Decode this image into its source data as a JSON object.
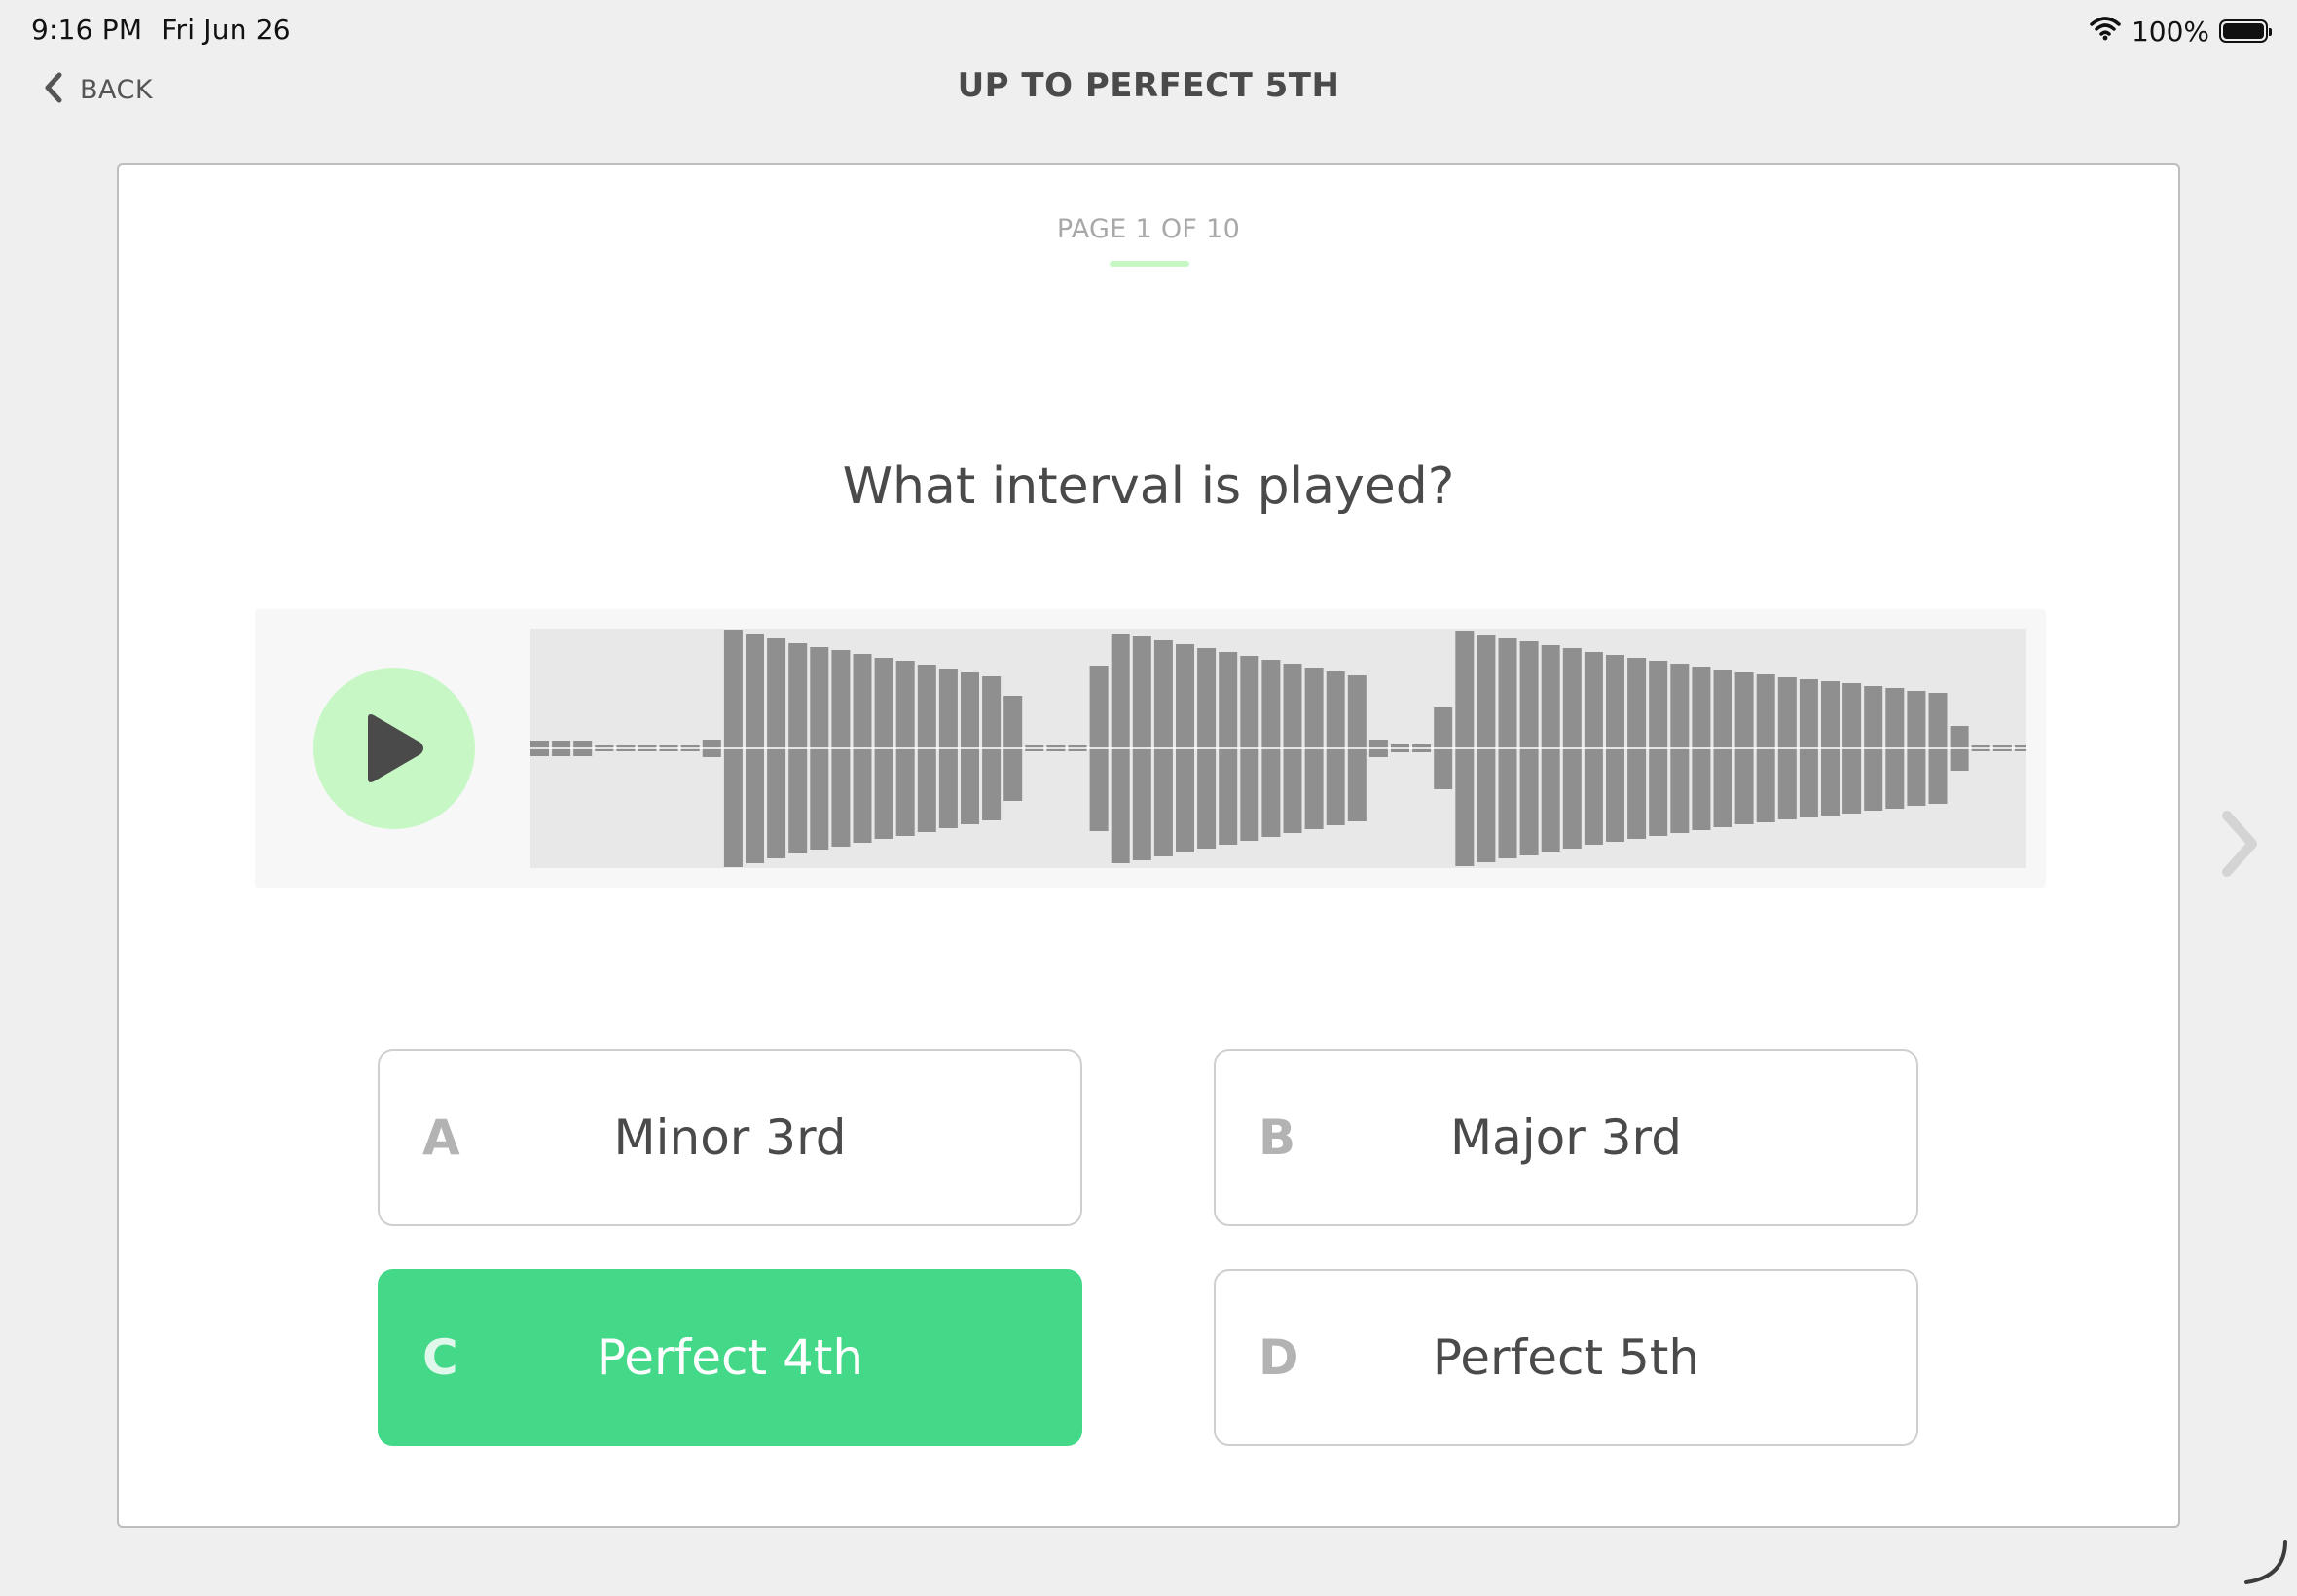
{
  "status_bar": {
    "time": "9:16 PM",
    "date": "Fri Jun 26",
    "battery": "100%",
    "battery_level": 1.0,
    "icons": [
      "wifi-icon",
      "battery-icon"
    ]
  },
  "header": {
    "back_label": "BACK",
    "title": "UP TO PERFECT 5TH"
  },
  "quiz": {
    "page_indicator": "PAGE 1 OF 10",
    "current_page": 1,
    "total_pages": 10,
    "question": "What interval is played?"
  },
  "player": {
    "icon": "play-icon"
  },
  "answers": [
    {
      "letter": "A",
      "text": "Minor 3rd",
      "selected": false
    },
    {
      "letter": "B",
      "text": "Major 3rd",
      "selected": false
    },
    {
      "letter": "C",
      "text": "Perfect 4th",
      "selected": true
    },
    {
      "letter": "D",
      "text": "Perfect 5th",
      "selected": false
    }
  ],
  "colors": {
    "accent_green": "#43d989",
    "light_green": "#c8f7c6",
    "waveform_bar": "#8f8f8f",
    "waveform_bg": "#e8e8e8",
    "background": "#efefef"
  }
}
